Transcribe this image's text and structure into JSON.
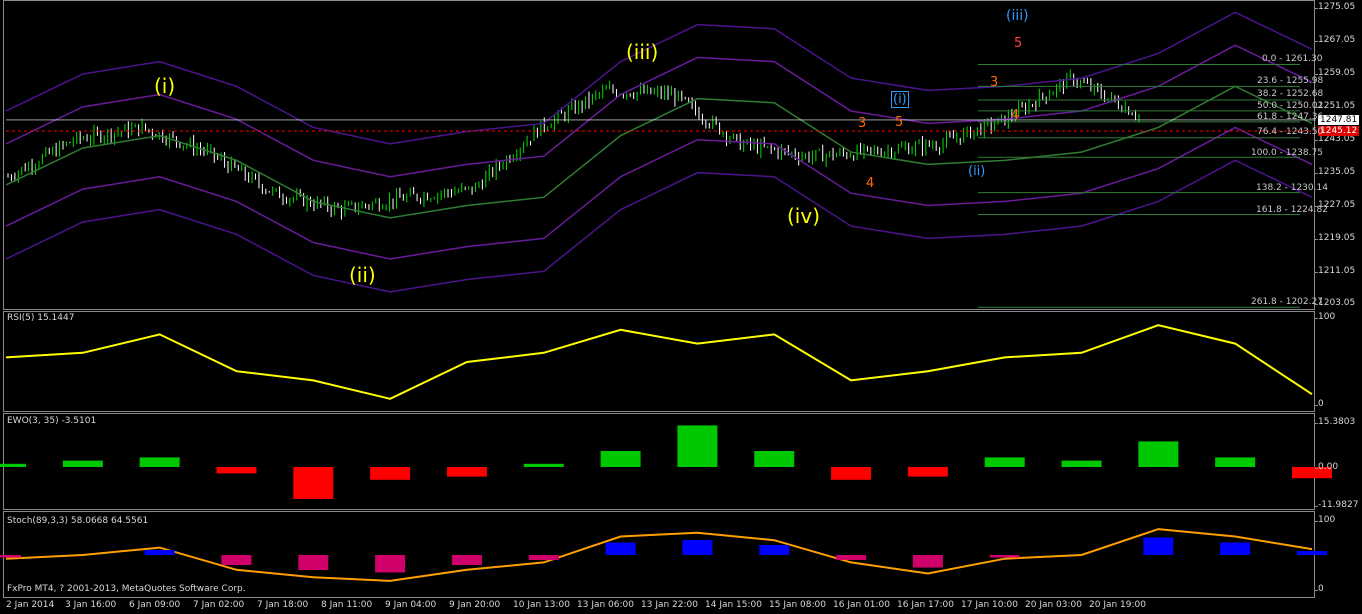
{
  "colors": {
    "background": "#000000",
    "bull_candle": "#00e000",
    "bear_candle": "#ffffff",
    "wave_label": "#ffff00",
    "subwave_label": "#ff6a00",
    "minor_wave_label": "#3399ff",
    "rsi_line": "#ffff00",
    "ewo_up": "#00c800",
    "ewo_down": "#ff0000",
    "ewo_blue": "#0000ff",
    "stoch_hist_up": "#0000ff",
    "stoch_hist_down": "#d0006a",
    "bid_line": "#ffffff",
    "red_line": "#ff0000"
  },
  "price_panel": {
    "axis_ticks": [
      "1275.05",
      "1267.05",
      "1259.05",
      "1251.05",
      "1243.05",
      "1235.05",
      "1227.05",
      "1219.05",
      "1211.05",
      "1203.05"
    ],
    "bid_label": "1247.81",
    "red_label": "1245.12",
    "wave_labels": {
      "i": "(i)",
      "ii": "(ii)",
      "iii": "(iii)",
      "iv": "(iv)",
      "blue_iii": "(iii)",
      "blue_ii": "(ii)",
      "blue_i": "(i)"
    },
    "subwave_numbers": {
      "a": "3",
      "b": "5",
      "c": "4",
      "d": "3",
      "e": "4",
      "f": "5"
    },
    "fib_levels": [
      {
        "label": "0.0 - 1261.30"
      },
      {
        "label": "23.6 - 1255.98"
      },
      {
        "label": "38.2 - 1252.68"
      },
      {
        "label": "50.0 - 1250.02"
      },
      {
        "label": "61.8 - 1247.36"
      },
      {
        "label": "76.4 - 1243.50"
      },
      {
        "label": "100.0 - 1238.75"
      },
      {
        "label": "138.2 - 1230.14"
      },
      {
        "label": "161.8 - 1224.82"
      },
      {
        "label": "261.8 - 1202.27"
      }
    ]
  },
  "rsi_panel": {
    "label": "RSI(5) 15.1447",
    "axis_ticks": [
      "100",
      "0"
    ]
  },
  "ewo_panel": {
    "label": "EWO(3, 35) -3.5101",
    "axis_ticks": [
      "15.3803",
      "0.00",
      "-11.9827"
    ]
  },
  "stoch_panel": {
    "label": "Stoch(89,3,3) 58.0668 64.5561",
    "axis_ticks": [
      "100",
      "0"
    ],
    "copyright": "FxPro MT4, ? 2001-2013, MetaQuotes Software Corp."
  },
  "time_axis": [
    "2 Jan 2014",
    "3 Jan 16:00",
    "6 Jan 09:00",
    "7 Jan 02:00",
    "7 Jan 18:00",
    "8 Jan 11:00",
    "9 Jan 04:00",
    "9 Jan 20:00",
    "10 Jan 13:00",
    "13 Jan 06:00",
    "13 Jan 22:00",
    "14 Jan 15:00",
    "15 Jan 08:00",
    "16 Jan 01:00",
    "16 Jan 17:00",
    "17 Jan 10:00",
    "20 Jan 03:00",
    "20 Jan 19:00"
  ],
  "chart_data": {
    "type": "line",
    "title": "",
    "xlabel": "",
    "ylabel": "",
    "ylim": [
      1203.05,
      1275.05
    ],
    "x": [
      "2 Jan 2014",
      "3 Jan 16:00",
      "6 Jan 09:00",
      "7 Jan 02:00",
      "7 Jan 18:00",
      "8 Jan 11:00",
      "9 Jan 04:00",
      "9 Jan 20:00",
      "10 Jan 13:00",
      "13 Jan 06:00",
      "13 Jan 22:00",
      "14 Jan 15:00",
      "15 Jan 08:00",
      "16 Jan 01:00",
      "16 Jan 17:00",
      "17 Jan 10:00",
      "20 Jan 03:00",
      "20 Jan 19:00"
    ],
    "series": [
      {
        "values": [
          1234,
          1243,
          1246,
          1240,
          1230,
          1226,
          1229,
          1231,
          1246,
          1255,
          1254,
          1242,
          1239,
          1240,
          1242,
          1248,
          1258,
          1249
        ]
      }
    ],
    "rsi": [
      55,
      60,
      80,
      40,
      30,
      10,
      50,
      60,
      85,
      70,
      80,
      30,
      40,
      55,
      60,
      90,
      70,
      15
    ],
    "ewo": [
      1,
      2,
      3,
      -2,
      -10,
      -4,
      -3,
      1,
      5,
      13,
      5,
      -4,
      -3,
      3,
      2,
      8,
      3,
      -3.5
    ],
    "stoch": [
      45,
      50,
      60,
      30,
      20,
      15,
      30,
      40,
      75,
      80,
      70,
      40,
      25,
      45,
      50,
      85,
      75,
      58
    ]
  }
}
